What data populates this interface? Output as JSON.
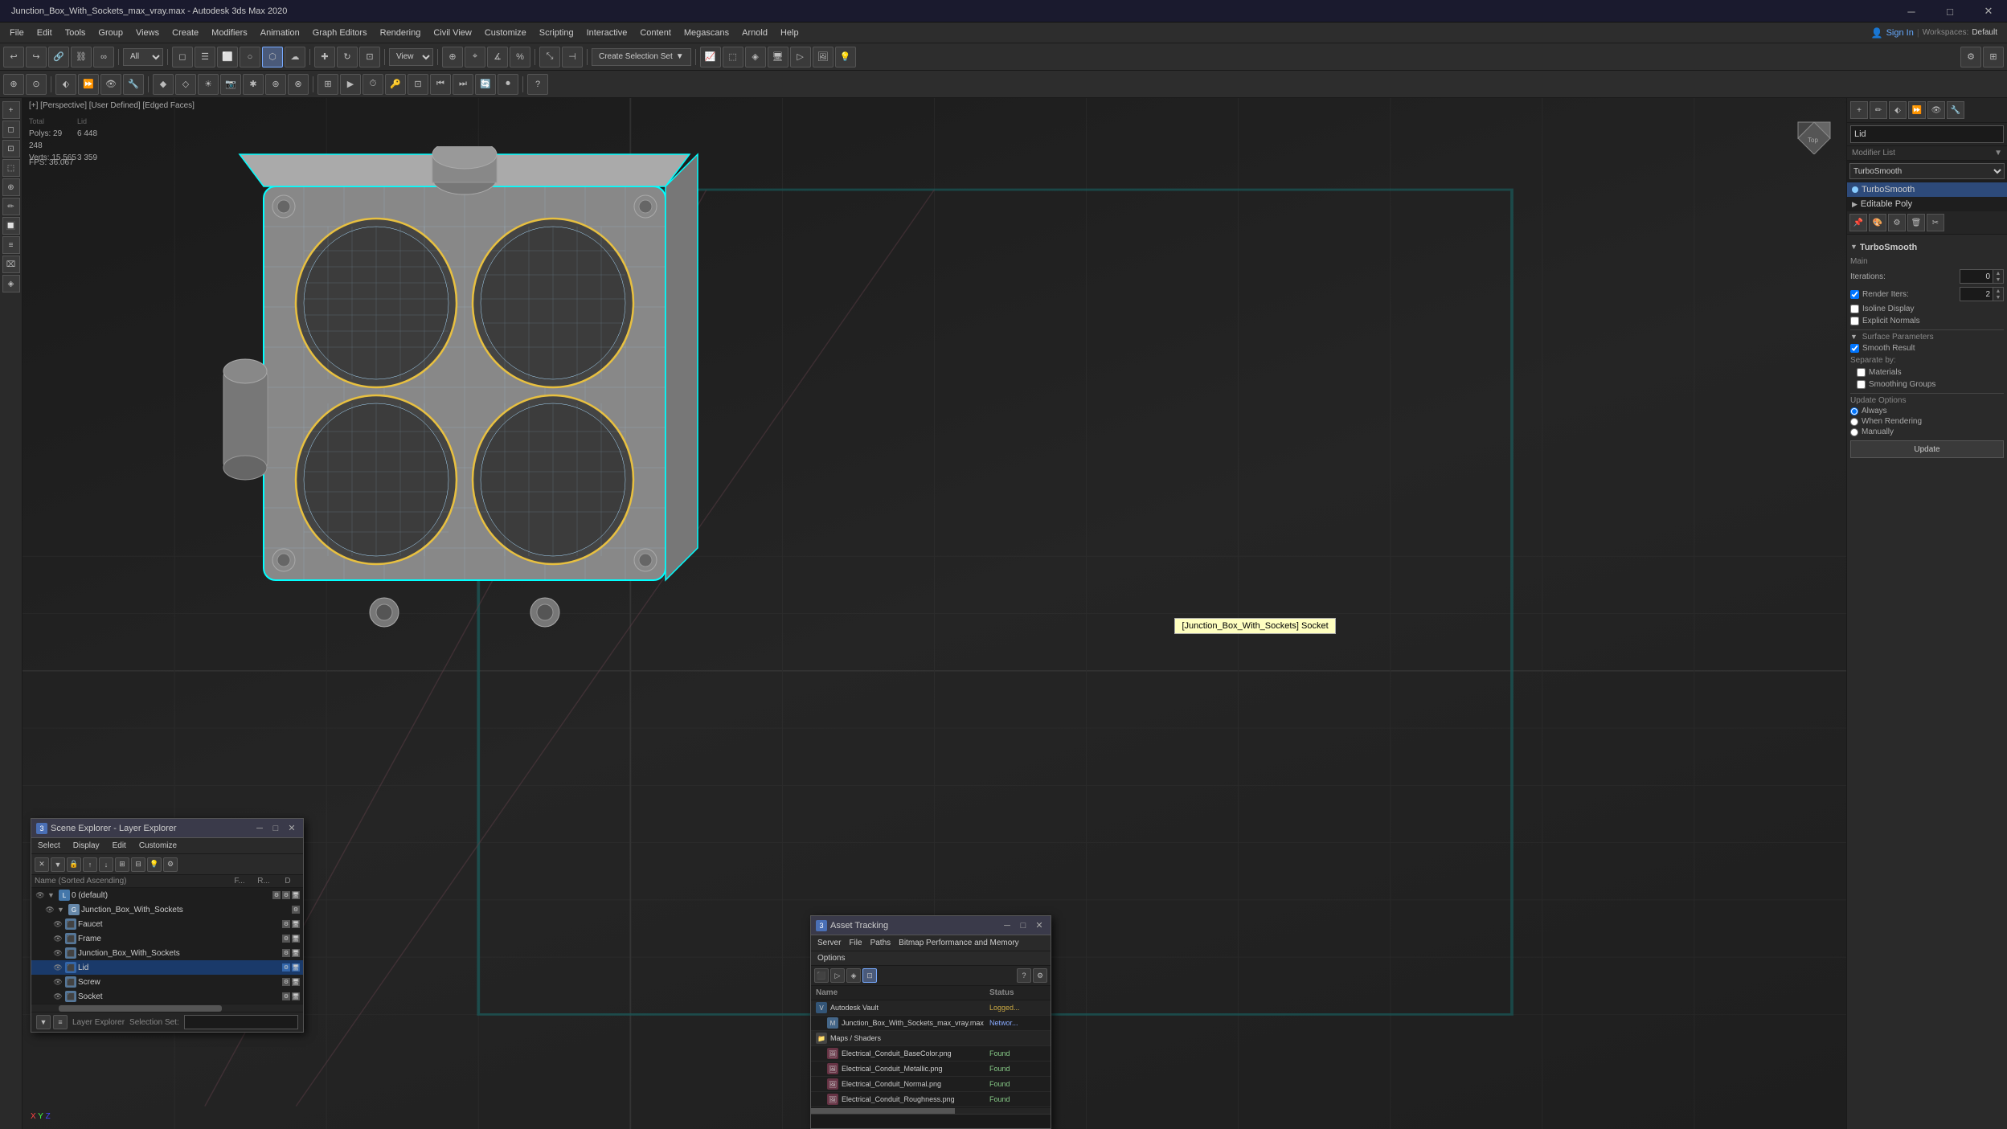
{
  "window": {
    "title": "Junction_Box_With_Sockets_max_vray.max - Autodesk 3ds Max 2020",
    "controls": [
      "minimize",
      "maximize",
      "close"
    ]
  },
  "menu": {
    "items": [
      "File",
      "Edit",
      "Tools",
      "Group",
      "Views",
      "Create",
      "Modifiers",
      "Animation",
      "Graph Editors",
      "Rendering",
      "Civil View",
      "Customize",
      "Scripting",
      "Interactive",
      "Content",
      "Megascans",
      "Arnold",
      "Help"
    ]
  },
  "toolbar": {
    "view_mode": "View",
    "create_selection_set": "Create Selection Set",
    "layer_dropdown": "All"
  },
  "viewport": {
    "header": "[+] [Perspective] [User Defined] [Edged Faces]",
    "stats_total_polys": "Polys: 29 248",
    "stats_lid_polys": "6 448",
    "stats_total_verts": "Verts: 15 565",
    "stats_lid_verts": "3 359",
    "fps": "FPS: 36.067",
    "tooltip": "[Junction_Box_With_Sockets] Socket",
    "axis": "XYZ"
  },
  "right_panel": {
    "object_name": "Lid",
    "modifier_list_label": "Modifier List",
    "modifiers": [
      {
        "name": "TurboSmooth",
        "active": true
      },
      {
        "name": "Editable Poly",
        "active": false
      }
    ],
    "icon_strip_icons": [
      "pin",
      "color",
      "edit",
      "delete",
      "cut"
    ],
    "turbosmooth": {
      "title": "TurboSmooth",
      "main_label": "Main",
      "iterations_label": "Iterations:",
      "iterations_value": "0",
      "render_iters_label": "Render Iters:",
      "render_iters_value": "2",
      "isoline_display": "Isoline Display",
      "explicit_normals": "Explicit Normals",
      "surface_params": "Surface Parameters",
      "smooth_result": "Smooth Result",
      "smooth_result_checked": true,
      "separate_by": "Separate by:",
      "materials": "Materials",
      "smoothing_groups": "Smoothing Groups",
      "update_options": "Update Options",
      "always": "Always",
      "when_rendering": "When Rendering",
      "manually": "Manually",
      "update_btn": "Update"
    }
  },
  "scene_explorer": {
    "title": "Scene Explorer - Layer Explorer",
    "menu_items": [
      "Select",
      "Display",
      "Edit",
      "Customize"
    ],
    "columns": {
      "name": "Name (Sorted Ascending)",
      "freeze": "F...",
      "render": "R...",
      "d": "D"
    },
    "tree": [
      {
        "level": 0,
        "name": "0 (default)",
        "type": "layer",
        "expanded": true
      },
      {
        "level": 1,
        "name": "Junction_Box_With_Sockets",
        "type": "group",
        "expanded": true,
        "selected": false
      },
      {
        "level": 2,
        "name": "Faucet",
        "type": "object"
      },
      {
        "level": 2,
        "name": "Frame",
        "type": "object"
      },
      {
        "level": 2,
        "name": "Junction_Box_With_Sockets",
        "type": "object"
      },
      {
        "level": 2,
        "name": "Lid",
        "type": "object",
        "selected": true
      },
      {
        "level": 2,
        "name": "Screw",
        "type": "object"
      },
      {
        "level": 2,
        "name": "Socket",
        "type": "object"
      }
    ],
    "footer_label": "Layer Explorer",
    "selection_set_label": "Selection Set:"
  },
  "asset_tracking": {
    "title": "Asset Tracking",
    "menu_items": [
      "Server",
      "File",
      "Paths",
      "Bitmap Performance and Memory",
      "Options"
    ],
    "columns": {
      "name": "Name",
      "status": "Status"
    },
    "rows": [
      {
        "level": 0,
        "name": "Autodesk Vault",
        "status": "Logged...",
        "status_type": "logged"
      },
      {
        "level": 1,
        "name": "Junction_Box_With_Sockets_max_vray.max",
        "status": "Networ...",
        "status_type": "network"
      },
      {
        "level": 0,
        "name": "Maps / Shaders",
        "status": "",
        "status_type": ""
      },
      {
        "level": 1,
        "name": "Electrical_Conduit_BaseColor.png",
        "status": "Found",
        "status_type": "found"
      },
      {
        "level": 1,
        "name": "Electrical_Conduit_Metallic.png",
        "status": "Found",
        "status_type": "found"
      },
      {
        "level": 1,
        "name": "Electrical_Conduit_Normal.png",
        "status": "Found",
        "status_type": "found"
      },
      {
        "level": 1,
        "name": "Electrical_Conduit_Roughness.png",
        "status": "Found",
        "status_type": "found"
      }
    ]
  },
  "icons": {
    "cube": "⬛",
    "eye": "👁",
    "lock": "🔒",
    "arrow_right": "▶",
    "arrow_down": "▼",
    "close": "✕",
    "minimize": "─",
    "maximize": "□",
    "pin": "📌",
    "color": "🎨",
    "edit": "✏",
    "delete": "🗑",
    "cut": "✂"
  },
  "colors": {
    "accent_cyan": "#00ffff",
    "accent_yellow": "#f0c040",
    "accent_blue": "#4a6fa5",
    "bg_dark": "#1e1e1e",
    "bg_mid": "#2d2d2d",
    "bg_panel": "#2a2a2a",
    "text_dim": "#888888",
    "text_normal": "#cccccc",
    "found_green": "#88cc88",
    "network_blue": "#88aaff",
    "logged_yellow": "#ccaa44"
  }
}
